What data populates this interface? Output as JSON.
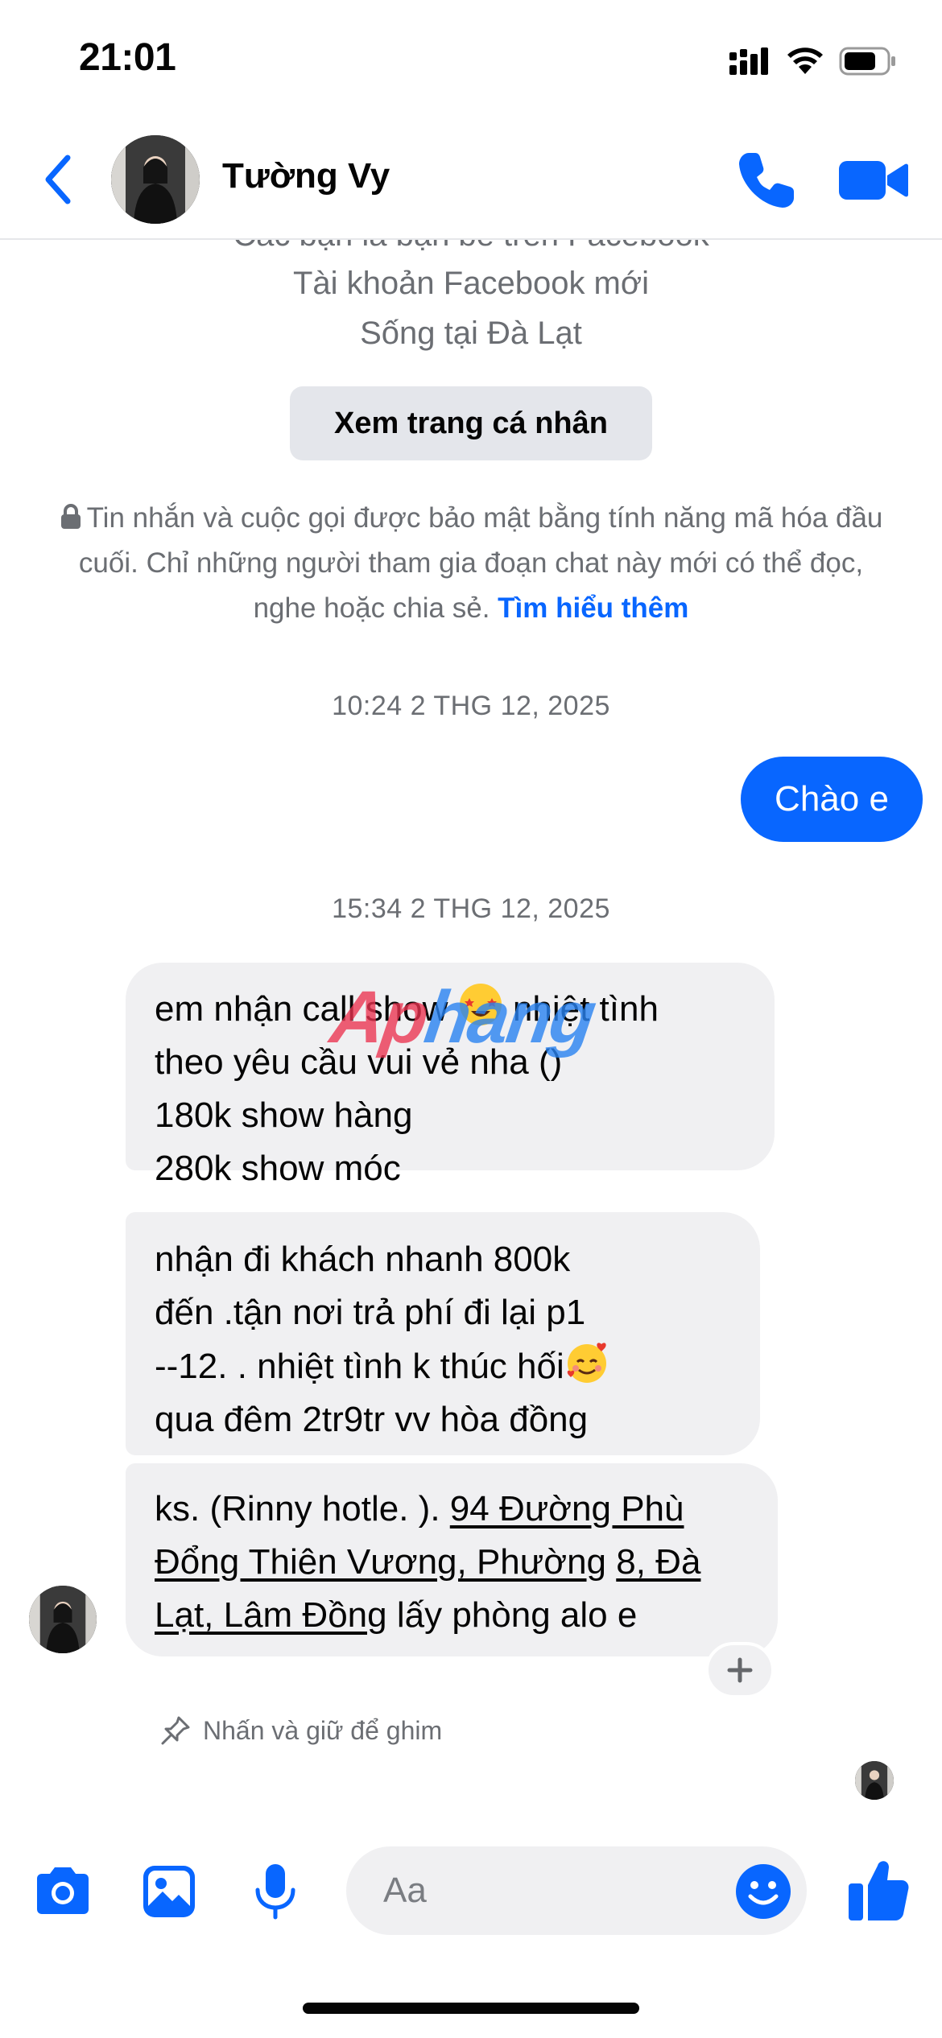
{
  "status_bar": {
    "time": "21:01"
  },
  "header": {
    "contact_name": "Tường Vy"
  },
  "profile_info": {
    "friends_line": "Các bạn là bạn bè trên Facebook",
    "account_line": "Tài khoản Facebook mới",
    "location_line": "Sống tại Đà Lạt",
    "view_profile_label": "Xem trang cá nhân"
  },
  "encryption_notice": {
    "text": "Tin nhắn và cuộc gọi được bảo mật bằng tính năng mã hóa đầu cuối. Chỉ những người tham gia đoạn chat này mới có thể đọc, nghe hoặc chia sẻ.",
    "link_label": "Tìm hiểu thêm"
  },
  "conversation": {
    "timestamp_1": "10:24 2 THG 12, 2025",
    "outgoing_1": "Chào e",
    "timestamp_2": "15:34 2 THG 12, 2025",
    "incoming_1": {
      "line1_a": "em nhận call show ",
      "line1_b": " nhiệt tình",
      "line2": "theo yêu cầu  vui vẻ nha  ()",
      "line3": "180k show  hàng",
      "line4": "280k  show móc"
    },
    "incoming_2": {
      "line1": "nhận đi khách nhanh  800k",
      "line2": "đến .tận nơi  trả phí đi lại  p1",
      "line3": "--12. .  nhiệt tình    k thúc  hối",
      "line4": "qua đêm  2tr9tr vv hòa đồng"
    },
    "incoming_3": {
      "prefix": "ks. (Rinny hotle. ). ",
      "address_a": "94 Đường Phù",
      "address_b": "Đổng Thiên Vương, Phường",
      "space": " ",
      "address_c": "8, Đà",
      "address_d": "Lạt, Lâm Đồng",
      "suffix": "  lấy phòng alo e"
    },
    "pin_hint": "Nhấn và giữ để ghim"
  },
  "watermark": {
    "part1": "Ap",
    "part2": "hang"
  },
  "composer": {
    "placeholder": "Aa"
  },
  "colors": {
    "accent": "#0866ff",
    "bubble_in": "#f0f0f2",
    "muted_text": "#6b6e73"
  }
}
